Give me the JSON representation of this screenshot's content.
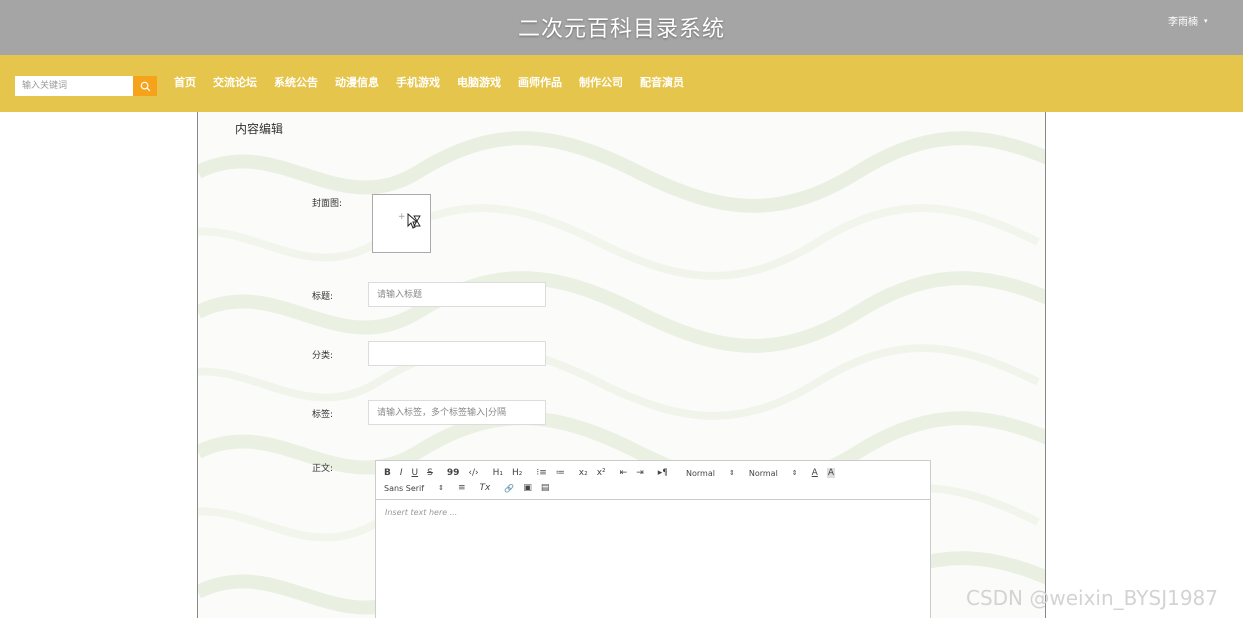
{
  "header": {
    "site_title": "二次元百科目录系统",
    "user_name": "李雨楠",
    "user_caret": "▾"
  },
  "search": {
    "placeholder": "输入关键词",
    "button_icon": "search-icon"
  },
  "nav": {
    "items": [
      "首页",
      "交流论坛",
      "系统公告",
      "动漫信息",
      "手机游戏",
      "电脑游戏",
      "画师作品",
      "制作公司",
      "配音演员"
    ]
  },
  "form": {
    "section_title": "内容编辑",
    "cover_label": "封面图:",
    "cover_plus": "+",
    "title_label": "标题:",
    "title_placeholder": "请输入标题",
    "category_label": "分类:",
    "category_value": "",
    "tags_label": "标签:",
    "tags_placeholder": "请输入标签，多个标签输入|分隔",
    "body_label": "正文:"
  },
  "editor": {
    "toolbar_row1": {
      "bold": "B",
      "italic": "I",
      "underline": "U",
      "strike": "S",
      "quote": "99",
      "code": "‹/›",
      "h1": "H₁",
      "h2": "H₂",
      "ordered_list": "⁝≡",
      "bullet_list": "≔",
      "subscript": "x₂",
      "superscript": "x²",
      "indent_decrease": "⇤",
      "indent_increase": "⇥",
      "direction": "▸¶",
      "size_select": "Normal",
      "header_select": "Normal",
      "font_color": "A",
      "background_color": "A"
    },
    "toolbar_row2": {
      "font_select": "Sans Serif",
      "align": "≡",
      "clear_format": "Tx",
      "link": "🔗",
      "image": "▣",
      "video": "▤"
    },
    "select_arrows": "⇕",
    "placeholder": "Insert text here ..."
  },
  "watermark": "CSDN @weixin_BYSJ1987",
  "colors": {
    "topbar": "#a5a5a5",
    "navbar": "#e6c54c",
    "search_button": "#f7a21b"
  }
}
